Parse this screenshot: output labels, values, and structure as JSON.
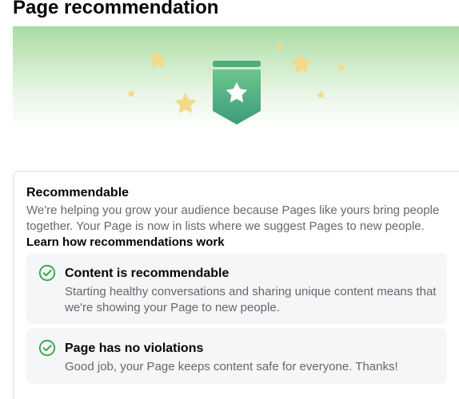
{
  "page_title": "Page recommendation",
  "hero": {
    "badge_icon": "star-badge-icon",
    "decoration_icon": "star-icon",
    "colors": {
      "badge_top": "#65c086",
      "badge_bottom": "#3f9f7e",
      "star": "#f3d98a"
    }
  },
  "recommendation": {
    "title": "Recommendable",
    "description": "We're helping you grow your audience because Pages like yours bring people together. Your Page is now in lists where we suggest Pages to new people.",
    "link_label": "Learn how recommendations work",
    "items": [
      {
        "icon": "check-circle-icon",
        "title": "Content is recommendable",
        "description": "Starting healthy conversations and sharing unique content means that we're showing your Page to new people."
      },
      {
        "icon": "check-circle-icon",
        "title": "Page has no violations",
        "description": "Good job, your Page keeps content safe for everyone. Thanks!"
      }
    ],
    "colors": {
      "check": "#31a24c"
    }
  }
}
